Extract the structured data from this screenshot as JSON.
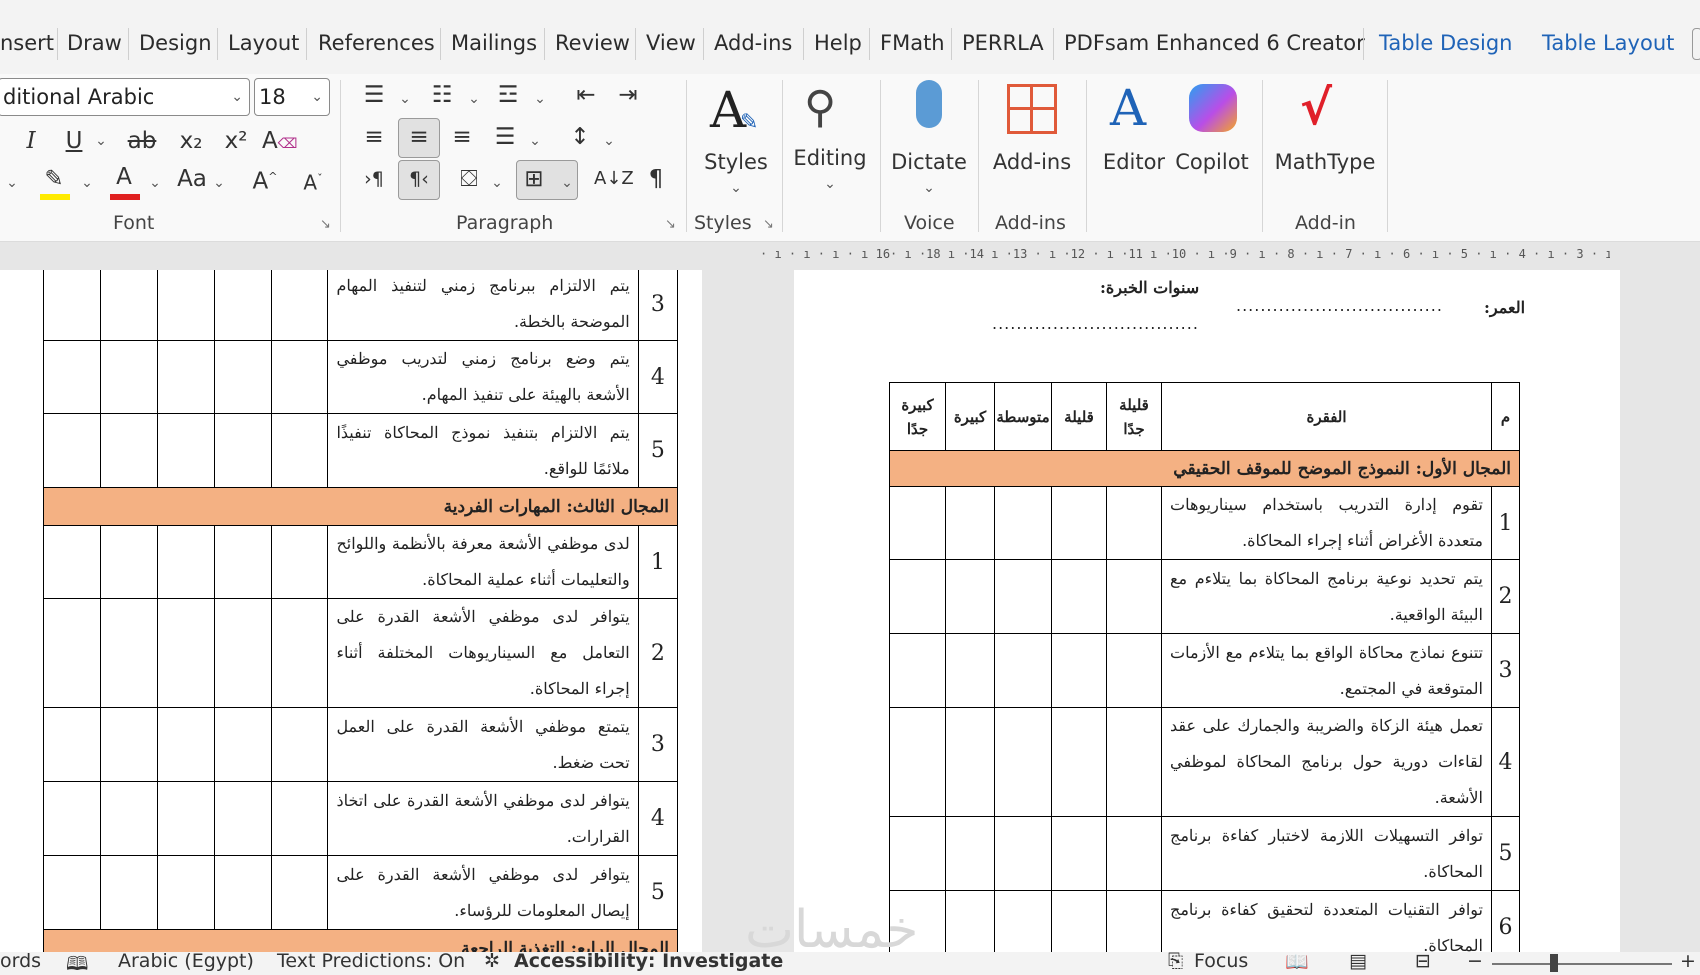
{
  "tabs": [
    "nsert",
    "Draw",
    "Design",
    "Layout",
    "References",
    "Mailings",
    "Review",
    "View",
    "Add-ins",
    "Help",
    "FMath",
    "PERRLA",
    "PDFsam Enhanced 6 Creator"
  ],
  "context_tabs": [
    "Table Design",
    "Table Layout"
  ],
  "ribbon": {
    "font_name": "ditional Arabic",
    "font_size": "18",
    "groups": {
      "font": "Font",
      "paragraph": "Paragraph",
      "styles": "Styles",
      "voice": "Voice",
      "addins": "Add-ins",
      "addin": "Add-in"
    },
    "buttons": {
      "styles": "Styles",
      "editing": "Editing",
      "dictate": "Dictate",
      "addins": "Add-ins",
      "editor": "Editor",
      "copilot": "Copilot",
      "mathtype": "MathType"
    },
    "font_case": "Aa"
  },
  "ruler_text": "· ı · ı · ı · ı 16· ı ·18 ı ·14 ı ·13 · ı ·12 · ı ·11 ı ·10 · ı ·9 · ı · 8 · ı · 7 · ı · 6 · ı · 5 · ı · 4 · ı · 3 · ı · 2 · ı · 1 · ı · ı · ı · ı · ı · ı",
  "left_page": {
    "rows": [
      {
        "num": "3",
        "text": "يتم الالتزام ببرنامج زمني لتنفيذ المهام الموضحة بالخطة."
      },
      {
        "num": "4",
        "text": "يتم وضع برنامج زمني لتدريب موظفي الأشعة بالهيئة على تنفيذ المهام."
      },
      {
        "num": "5",
        "text": "يتم الالتزام بتنفيذ نموذج المحاكاة تنفيذًا ملائمًا للواقع."
      }
    ],
    "domain3": "المجال الثالث: المهارات الفردية",
    "rows3": [
      {
        "num": "1",
        "text": "لدى موظفي الأشعة معرفة بالأنظمة واللوائح والتعليمات أثناء عملية المحاكاة."
      },
      {
        "num": "2",
        "text": "يتوافر لدى موظفي الأشعة القدرة على التعامل مع السيناريوهات المختلفة أثناء إجراء المحاكاة."
      },
      {
        "num": "3",
        "text": "يتمتع موظفي الأشعة القدرة على العمل تحت ضغط."
      },
      {
        "num": "4",
        "text": "يتوافر لدى موظفي الأشعة القدرة على اتخاذ القرارات."
      },
      {
        "num": "5",
        "text": "يتوافر لدى موظفي الأشعة القدرة على إيصال المعلومات للرؤساء."
      }
    ],
    "domain4": "المجال الرابع: التغذية الراجعة"
  },
  "right_page": {
    "experience_label": "سنوات الخبرة:",
    "age_label": "العمر:",
    "age_dots": "..................................",
    "experience_dots": "..................................",
    "headers": {
      "m": "م",
      "item": "الفقرة",
      "very_low": "قليلة جدًا",
      "low": "قليلة",
      "medium": "متوسطة",
      "high": "كبيرة",
      "very_high": "كبيرة جدًا"
    },
    "domain1": "المجال الأول: النموذج الموضح للموقف الحقيقي",
    "rows": [
      {
        "num": "1",
        "text": "تقوم إدارة التدريب باستخدام سيناريوهات متعددة الأغراض أثناء إجراء المحاكاة."
      },
      {
        "num": "2",
        "text": "يتم تحديد نوعية برنامج المحاكاة بما يتلاءم مع البيئة الواقعية."
      },
      {
        "num": "3",
        "text": "تتنوع نماذج محاكاة الواقع بما يتلاءم مع الأزمات المتوقعة في المجتمع."
      },
      {
        "num": "4",
        "text": "تعمل هيئة الزكاة والضريبة والجمارك على عقد لقاءات دورية حول برنامج المحاكاة لموظفي الأشعة."
      },
      {
        "num": "5",
        "text": "توافر التسهيلات اللازمة لاختبار كفاءة برنامج المحاكاة."
      },
      {
        "num": "6",
        "text": "توافر التقنيات المتعددة لتحقيق كفاءة برنامج المحاكاة."
      }
    ]
  },
  "watermark": "خمسات",
  "status": {
    "words": "ords",
    "language": "Arabic (Egypt)",
    "predictions": "Text Predictions: On",
    "accessibility": "Accessibility: Investigate",
    "focus": "Focus"
  }
}
